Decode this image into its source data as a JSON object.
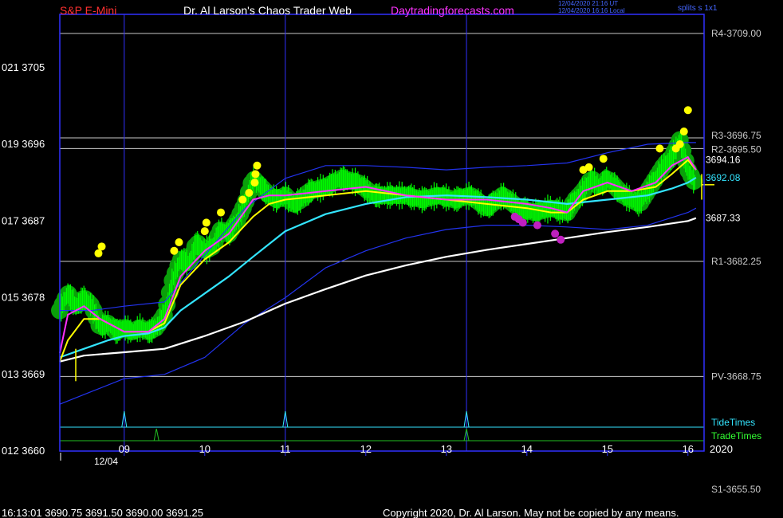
{
  "header": {
    "instrument": "S&P E-Mini",
    "title": "Dr. Al Larson's Chaos Trader Web",
    "site": "Daytradingforecasts.com",
    "timestamp_ut": "12/04/2020 21:16 UT",
    "timestamp_local": "12/04/2020 16:16 Local",
    "splits": "splits s 1x1"
  },
  "footer": {
    "quote": "16:13:01  3690.75 3691.50 3690.00 3691.25",
    "copyright": "Copyright 2020, Dr. Al Larson. May not be copied by any means.",
    "date_label": "12/04",
    "year_label": "2020"
  },
  "legend": {
    "tide": "TideTimes",
    "trade": "TradeTimes"
  },
  "colors": {
    "background": "#000000",
    "frame": "#3030ff",
    "price": "#00ff00",
    "halo": "#0aa00a",
    "ema_fast": "#ff30ff",
    "ema_mid": "#ffff00",
    "ema_cyan": "#33e5ff",
    "ema_slow": "#ffffff",
    "band": "#2233ee",
    "levels": "#c8c8c8",
    "instrument": "#ff3030",
    "title": "#ffffff",
    "site": "#ff33ff"
  },
  "chart_data": {
    "type": "line",
    "ylim": [
      3660,
      3709
    ],
    "xlim": [
      8.2,
      16.2
    ],
    "y_ticks": [
      {
        "label": "021  3705",
        "value": 3705
      },
      {
        "label": "019  3696",
        "value": 3696
      },
      {
        "label": "017  3687",
        "value": 3687
      },
      {
        "label": "015  3678",
        "value": 3678
      },
      {
        "label": "013  3669",
        "value": 3669
      },
      {
        "label": "012  3660",
        "value": 3660
      }
    ],
    "x_ticks": [
      {
        "label": "09",
        "value": 9
      },
      {
        "label": "10",
        "value": 10
      },
      {
        "label": "11",
        "value": 11
      },
      {
        "label": "12",
        "value": 12
      },
      {
        "label": "13",
        "value": 13
      },
      {
        "label": "14",
        "value": 14
      },
      {
        "label": "15",
        "value": 15
      },
      {
        "label": "16",
        "value": 16
      }
    ],
    "levels": [
      {
        "label": "R4-3709.00",
        "value": 3709.0
      },
      {
        "label": "R3-3696.75",
        "value": 3696.75
      },
      {
        "label": "R2-3695.50",
        "value": 3695.5
      },
      {
        "label": "R1-3682.25",
        "value": 3682.25
      },
      {
        "label": "PV-3668.75",
        "value": 3668.75
      },
      {
        "label": "S1-3655.50",
        "value": 3655.5
      }
    ],
    "value_labels": [
      {
        "label": "3694.16",
        "value": 3694.16,
        "series": "EMA yellow"
      },
      {
        "label": "3692.08",
        "value": 3692.08,
        "series": "EMA cyan"
      },
      {
        "label": "3687.33",
        "value": 3687.33,
        "series": "EMA white"
      }
    ],
    "tide_times": [
      9.0,
      11.0,
      13.25
    ],
    "trade_times": [
      9.4,
      13.25
    ],
    "blue_verticals": [
      9.0,
      11.0,
      13.25
    ],
    "series": [
      {
        "name": "price",
        "x": [
          8.2,
          8.3,
          8.4,
          8.5,
          8.6,
          8.7,
          8.8,
          8.9,
          9.0,
          9.1,
          9.2,
          9.3,
          9.4,
          9.5,
          9.6,
          9.7,
          9.8,
          9.9,
          10.0,
          10.1,
          10.2,
          10.3,
          10.4,
          10.5,
          10.6,
          10.7,
          10.8,
          10.9,
          11.0,
          11.1,
          11.2,
          11.3,
          11.5,
          11.7,
          11.9,
          12.1,
          12.3,
          12.5,
          12.7,
          12.9,
          13.1,
          13.3,
          13.5,
          13.7,
          13.9,
          14.1,
          14.3,
          14.5,
          14.6,
          14.7,
          14.8,
          14.9,
          15.0,
          15.2,
          15.4,
          15.5,
          15.6,
          15.7,
          15.8,
          15.9,
          16.0,
          16.1
        ],
        "y": [
          3676.5,
          3678.5,
          3677.0,
          3678.0,
          3677.0,
          3674.5,
          3675.0,
          3674.0,
          3674.5,
          3674.0,
          3674.5,
          3674.0,
          3674.5,
          3676.0,
          3680.0,
          3682.5,
          3682.0,
          3684.5,
          3683.5,
          3684.0,
          3686.0,
          3685.5,
          3687.0,
          3689.0,
          3692.0,
          3691.0,
          3690.0,
          3689.5,
          3690.0,
          3689.0,
          3689.5,
          3690.5,
          3691.0,
          3692.0,
          3691.5,
          3690.0,
          3690.0,
          3690.0,
          3689.5,
          3690.0,
          3689.5,
          3690.0,
          3688.5,
          3690.0,
          3688.5,
          3688.0,
          3688.5,
          3688.0,
          3689.5,
          3690.5,
          3692.0,
          3691.0,
          3692.0,
          3690.0,
          3689.0,
          3690.5,
          3692.0,
          3693.5,
          3694.5,
          3696.5,
          3693.0,
          3691.25
        ]
      },
      {
        "name": "EMA magenta",
        "x": [
          8.2,
          8.3,
          8.5,
          8.7,
          9.0,
          9.3,
          9.5,
          9.7,
          10.0,
          10.3,
          10.6,
          10.8,
          11.0,
          11.5,
          12.0,
          12.5,
          13.0,
          13.5,
          14.0,
          14.3,
          14.5,
          14.7,
          15.0,
          15.3,
          15.6,
          15.8,
          16.0,
          16.1
        ],
        "y": [
          3671.5,
          3676.0,
          3677.0,
          3675.5,
          3674.0,
          3674.0,
          3675.5,
          3680.5,
          3683.5,
          3685.5,
          3689.5,
          3690.0,
          3690.0,
          3690.5,
          3691.0,
          3690.0,
          3689.5,
          3689.5,
          3689.0,
          3688.5,
          3688.0,
          3690.5,
          3691.5,
          3690.5,
          3691.5,
          3693.5,
          3694.5,
          3693.0
        ]
      },
      {
        "name": "EMA yellow",
        "x": [
          8.2,
          8.3,
          8.5,
          8.7,
          9.0,
          9.3,
          9.5,
          9.7,
          10.0,
          10.3,
          10.6,
          10.8,
          11.0,
          11.5,
          12.0,
          12.5,
          13.0,
          13.5,
          14.0,
          14.3,
          14.5,
          14.7,
          15.0,
          15.3,
          15.6,
          15.8,
          16.0,
          16.1
        ],
        "y": [
          3670.5,
          3673.0,
          3675.5,
          3675.5,
          3674.0,
          3674.0,
          3675.0,
          3679.5,
          3682.5,
          3684.5,
          3687.5,
          3689.0,
          3689.5,
          3690.0,
          3690.5,
          3690.0,
          3689.5,
          3689.0,
          3688.5,
          3688.0,
          3688.0,
          3689.5,
          3690.5,
          3690.5,
          3691.0,
          3692.5,
          3694.16,
          3693.0
        ]
      },
      {
        "name": "EMA cyan",
        "x": [
          8.2,
          8.5,
          8.8,
          9.0,
          9.3,
          9.5,
          9.7,
          10.0,
          10.3,
          10.6,
          10.8,
          11.0,
          11.5,
          12.0,
          12.5,
          13.0,
          13.5,
          14.0,
          14.5,
          15.0,
          15.5,
          15.8,
          16.0,
          16.1
        ],
        "y": [
          3671.0,
          3672.0,
          3673.0,
          3673.5,
          3673.8,
          3674.5,
          3676.5,
          3678.5,
          3680.5,
          3682.8,
          3684.3,
          3685.8,
          3687.8,
          3689.0,
          3689.8,
          3690.0,
          3689.8,
          3689.5,
          3689.0,
          3689.5,
          3690.0,
          3690.8,
          3691.5,
          3692.08
        ]
      },
      {
        "name": "EMA white",
        "x": [
          8.2,
          8.5,
          9.0,
          9.5,
          10.0,
          10.5,
          11.0,
          11.5,
          12.0,
          12.5,
          13.0,
          13.5,
          14.0,
          14.5,
          15.0,
          15.5,
          16.0,
          16.1
        ],
        "y": [
          3670.5,
          3671.2,
          3671.6,
          3672.0,
          3673.5,
          3675.2,
          3677.3,
          3679.0,
          3680.6,
          3681.8,
          3682.8,
          3683.6,
          3684.3,
          3685.0,
          3685.7,
          3686.3,
          3687.0,
          3687.33
        ]
      },
      {
        "name": "band upper",
        "x": [
          8.2,
          8.6,
          9.0,
          9.5,
          10.0,
          10.5,
          11.0,
          11.5,
          12.0,
          12.5,
          13.0,
          13.5,
          14.0,
          14.5,
          15.0,
          15.5,
          16.0,
          16.1
        ],
        "y": [
          3676.5,
          3676.5,
          3677.0,
          3677.5,
          3683.0,
          3688.5,
          3692.0,
          3693.5,
          3693.5,
          3693.3,
          3693.0,
          3693.3,
          3693.5,
          3693.8,
          3695.0,
          3696.0,
          3696.2,
          3696.2
        ]
      },
      {
        "name": "band lower",
        "x": [
          8.2,
          8.6,
          9.0,
          9.5,
          10.0,
          10.5,
          11.0,
          11.5,
          12.0,
          12.5,
          13.0,
          13.5,
          14.0,
          14.5,
          15.0,
          15.5,
          16.0,
          16.1
        ],
        "y": [
          3665.5,
          3667.0,
          3668.5,
          3669.0,
          3671.0,
          3675.0,
          3678.0,
          3681.5,
          3683.5,
          3685.0,
          3686.0,
          3686.5,
          3686.5,
          3686.3,
          3686.0,
          3686.5,
          3688.0,
          3688.5
        ]
      }
    ],
    "yellow_dots": [
      [
        8.68,
        3683.2
      ],
      [
        8.72,
        3684.0
      ],
      [
        9.62,
        3683.5
      ],
      [
        9.68,
        3684.5
      ],
      [
        10.0,
        3685.8
      ],
      [
        10.02,
        3686.8
      ],
      [
        10.2,
        3688.0
      ],
      [
        10.47,
        3689.5
      ],
      [
        10.55,
        3690.3
      ],
      [
        10.62,
        3691.5
      ],
      [
        10.63,
        3692.5
      ],
      [
        10.65,
        3693.5
      ],
      [
        14.7,
        3693.0
      ],
      [
        14.77,
        3693.3
      ],
      [
        14.95,
        3694.3
      ],
      [
        15.65,
        3695.5
      ],
      [
        15.85,
        3695.5
      ],
      [
        15.9,
        3696.0
      ],
      [
        15.95,
        3697.5
      ],
      [
        16.0,
        3700.0
      ]
    ],
    "magenta_dots": [
      [
        13.85,
        3687.5
      ],
      [
        13.9,
        3687.2
      ],
      [
        13.95,
        3686.8
      ],
      [
        14.13,
        3686.5
      ],
      [
        14.35,
        3685.5
      ],
      [
        14.42,
        3684.8
      ]
    ]
  }
}
